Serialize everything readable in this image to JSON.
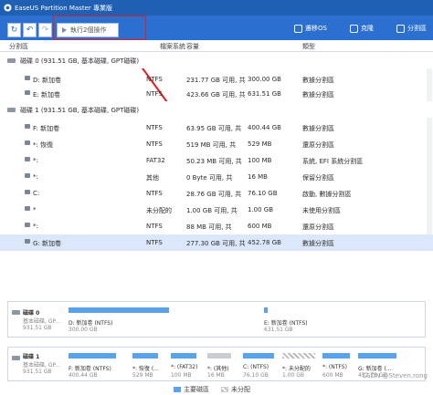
{
  "window": {
    "title": "EaseUS Partition Master 專業版"
  },
  "toolbar": {
    "exec_label": "執行2個操作",
    "migrate_label": "遷移OS",
    "clone_label": "克隆",
    "split_label": "分割區"
  },
  "table": {
    "headers": [
      "分割區",
      "檔案系統",
      "容量",
      "類型"
    ]
  },
  "disks": [
    {
      "label": "磁碟 0 (931.51 GB, 基本磁碟, GPT磁碟)",
      "parts": [
        {
          "name": "D: 新加卷",
          "fs": "NTFS",
          "cap": "231.77 GB 可用, 共",
          "total": "300.00 GB",
          "type": "數據分割區"
        },
        {
          "name": "E: 新加卷",
          "fs": "NTFS",
          "cap": "423.66 GB 可用, 共",
          "total": "631.51 GB",
          "type": "數據分割區"
        }
      ]
    },
    {
      "label": "磁碟 1 (931.51 GB, 基本磁碟, GPT磁碟)",
      "parts": [
        {
          "name": "F: 新加卷",
          "fs": "NTFS",
          "cap": "63.95 GB 可用, 共",
          "total": "400.44 GB",
          "type": "數據分割區"
        },
        {
          "name": "*: 恢復",
          "fs": "NTFS",
          "cap": "519 MB 可用, 共",
          "total": "529 MB",
          "type": "還原分割區"
        },
        {
          "name": "*:",
          "fs": "FAT32",
          "cap": "50.23 MB 可用, 共",
          "total": "100 MB",
          "type": "系統, EFI 系統分割區"
        },
        {
          "name": "*:",
          "fs": "其他",
          "cap": "0 Byte 可用, 共",
          "total": "16 MB",
          "type": "保留分割區"
        },
        {
          "name": "C:",
          "fs": "NTFS",
          "cap": "28.76 GB 可用, 共",
          "total": "76.10 GB",
          "type": "啟動, 數據分割區"
        },
        {
          "name": "*",
          "fs": "未分配的",
          "cap": "1.00 GB 可用, 共",
          "total": "1.00 GB",
          "type": "未使用分割區"
        },
        {
          "name": "*:",
          "fs": "NTFS",
          "cap": "88 MB 可用, 共",
          "total": "600 MB",
          "type": "還原分割區"
        },
        {
          "name": "G: 新加卷",
          "fs": "NTFS",
          "cap": "277.30 GB 可用, 共",
          "total": "452.78 GB",
          "type": "數據分割區"
        }
      ]
    }
  ],
  "map": {
    "disk0": {
      "name": "磁碟 0",
      "sub": "基本磁碟, GP...",
      "size": "931.51 GB",
      "parts": [
        {
          "label": "D: 新加卷 (NTFS)",
          "size": "300.00 GB"
        },
        {
          "label": "E: 新加卷 (NTFS)",
          "size": "631.51 GB"
        }
      ]
    },
    "disk1": {
      "name": "磁碟 1",
      "sub": "基本磁碟, GP...",
      "size": "931.51 GB",
      "parts": [
        {
          "label": "F: 新加卷 (NTFS)",
          "size": "400.44 GB"
        },
        {
          "label": "*: 恢復 (...",
          "size": "529 MB"
        },
        {
          "label": "*: (FAT32)",
          "size": "100 MB"
        },
        {
          "label": "*: (其他)",
          "size": "16 MB"
        },
        {
          "label": "C: (NTFS)",
          "size": "76.10 GB"
        },
        {
          "label": "*: 未分配的",
          "size": "1.00 GB"
        },
        {
          "label": "*: (NTFS)",
          "size": "600 MB"
        },
        {
          "label": "G: 新加卷 (...",
          "size": "452.78 GB"
        }
      ]
    }
  },
  "legend": {
    "primary": "主要磁區",
    "unalloc": "未分配"
  },
  "watermark": "CSDN @Steven.rong",
  "colors": {
    "titlebar": "#1f5fb4",
    "toolbar": "#2b6fd0",
    "partition_bar": "#5aa2ea",
    "highlight": "#e02020"
  }
}
